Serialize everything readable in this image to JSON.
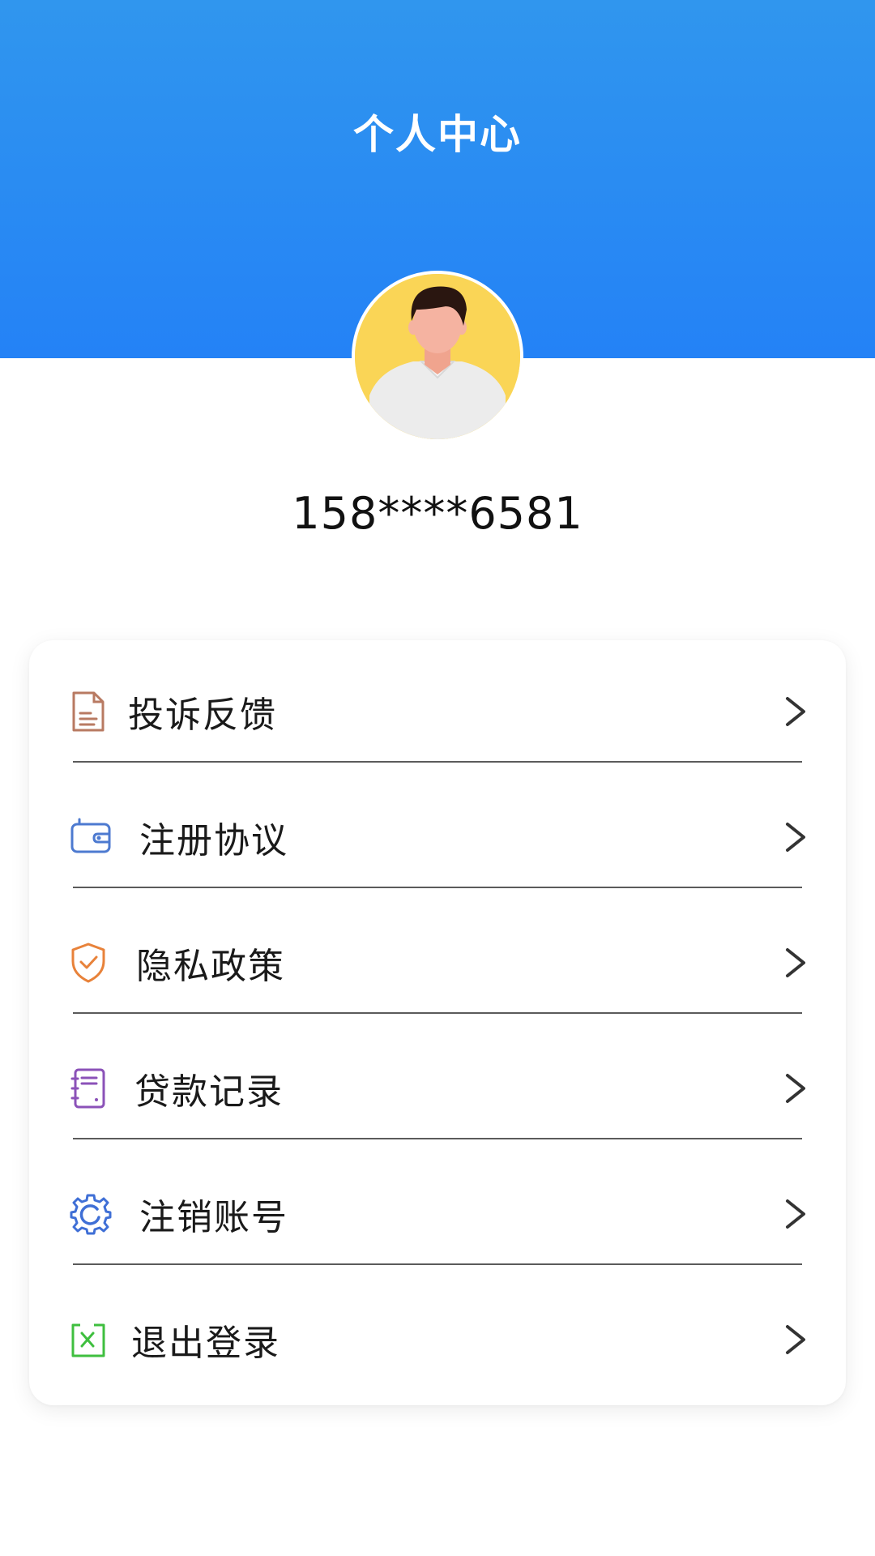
{
  "header": {
    "title": "个人中心"
  },
  "profile": {
    "phone": "158****6581"
  },
  "menu": [
    {
      "label": "投诉反馈",
      "icon": "document-icon",
      "color": "#b87a62"
    },
    {
      "label": "注册协议",
      "icon": "wallet-icon",
      "color": "#4d7ad0"
    },
    {
      "label": "隐私政策",
      "icon": "shield-check-icon",
      "color": "#e8823a"
    },
    {
      "label": "贷款记录",
      "icon": "notebook-icon",
      "color": "#8b52b8"
    },
    {
      "label": "注销账号",
      "icon": "gear-icon",
      "color": "#3f6fd6"
    },
    {
      "label": "退出登录",
      "icon": "exit-icon",
      "color": "#3fbf3f"
    }
  ],
  "colors": {
    "header_top": "#3096ee",
    "header_bottom": "#2482f6",
    "avatar_bg": "#fad556"
  }
}
